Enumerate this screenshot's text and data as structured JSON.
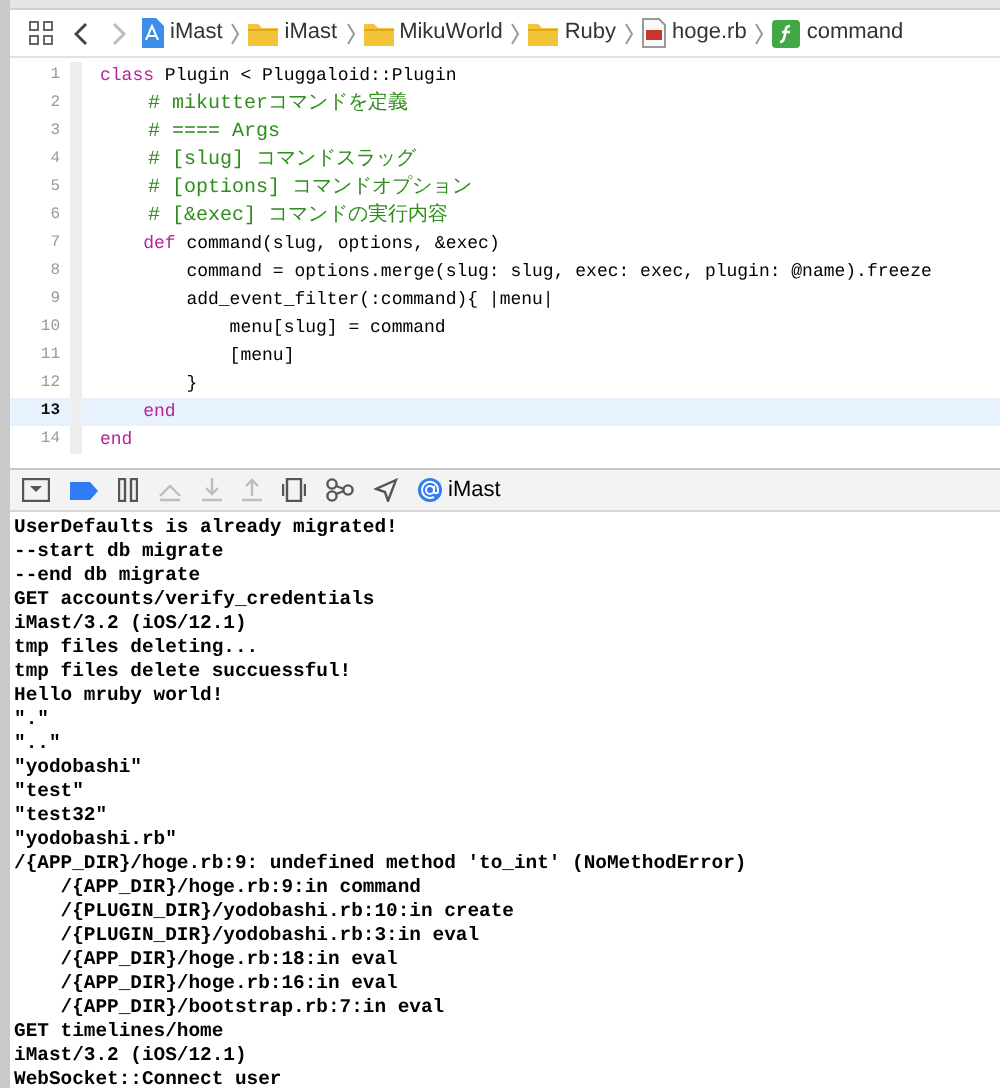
{
  "jump_bar": {
    "back": {
      "disabled": false
    },
    "forward": {
      "disabled": true
    },
    "path": [
      {
        "label": "iMast",
        "kind": "project"
      },
      {
        "label": "iMast",
        "kind": "folder"
      },
      {
        "label": "MikuWorld",
        "kind": "folder"
      },
      {
        "label": "Ruby",
        "kind": "folder"
      },
      {
        "label": "hoge.rb",
        "kind": "ruby-file"
      },
      {
        "label": "command",
        "kind": "function"
      }
    ]
  },
  "editor": {
    "lines": [
      {
        "number": "1",
        "current": false,
        "tokens": [
          {
            "text": "class",
            "kind": "keyword"
          },
          {
            "text": " Plugin < Pluggaloid::Plugin",
            "kind": "plain"
          }
        ]
      },
      {
        "number": "2",
        "current": false,
        "tokens": [
          {
            "text": "    # mikutterコマンドを定義",
            "kind": "comment"
          }
        ]
      },
      {
        "number": "3",
        "current": false,
        "tokens": [
          {
            "text": "    # ==== Args",
            "kind": "comment"
          }
        ]
      },
      {
        "number": "4",
        "current": false,
        "tokens": [
          {
            "text": "    # [slug] コマンドスラッグ",
            "kind": "comment"
          }
        ]
      },
      {
        "number": "5",
        "current": false,
        "tokens": [
          {
            "text": "    # [options] コマンドオプション",
            "kind": "comment"
          }
        ]
      },
      {
        "number": "6",
        "current": false,
        "tokens": [
          {
            "text": "    # [&exec] コマンドの実行内容",
            "kind": "comment"
          }
        ]
      },
      {
        "number": "7",
        "current": false,
        "tokens": [
          {
            "text": "    def",
            "kind": "keyword"
          },
          {
            "text": " command(slug, options, &exec)",
            "kind": "plain"
          }
        ]
      },
      {
        "number": "8",
        "current": false,
        "tokens": [
          {
            "text": "        command = options.merge(slug: slug, exec: exec, plugin: @name).freeze",
            "kind": "plain"
          }
        ]
      },
      {
        "number": "9",
        "current": false,
        "tokens": [
          {
            "text": "        add_event_filter(:command){ |menu|",
            "kind": "plain"
          }
        ]
      },
      {
        "number": "10",
        "current": false,
        "tokens": [
          {
            "text": "            menu[slug] = command",
            "kind": "plain"
          }
        ]
      },
      {
        "number": "11",
        "current": false,
        "tokens": [
          {
            "text": "            [menu]",
            "kind": "plain"
          }
        ]
      },
      {
        "number": "12",
        "current": false,
        "tokens": [
          {
            "text": "        }",
            "kind": "plain"
          }
        ]
      },
      {
        "number": "13",
        "current": true,
        "tokens": [
          {
            "text": "    end",
            "kind": "keyword"
          }
        ]
      },
      {
        "number": "14",
        "current": false,
        "tokens": [
          {
            "text": "end",
            "kind": "keyword"
          }
        ]
      }
    ]
  },
  "debug_bar": {
    "buttons": [
      {
        "kind": "hide-panel",
        "active": false,
        "disabled": false
      },
      {
        "kind": "breakpoints",
        "active": true,
        "disabled": false
      },
      {
        "kind": "pause",
        "active": false,
        "disabled": false
      },
      {
        "kind": "step-over",
        "active": false,
        "disabled": true
      },
      {
        "kind": "step-into",
        "active": false,
        "disabled": true
      },
      {
        "kind": "step-out",
        "active": false,
        "disabled": true
      },
      {
        "kind": "view-hierarchy",
        "active": false,
        "disabled": false
      },
      {
        "kind": "memory-graph",
        "active": false,
        "disabled": false
      },
      {
        "kind": "location",
        "active": false,
        "disabled": false
      }
    ],
    "process": "iMast"
  },
  "console": {
    "lines": [
      "UserDefaults is already migrated!",
      "--start db migrate",
      "--end db migrate",
      "GET accounts/verify_credentials",
      "iMast/3.2 (iOS/12.1)",
      "tmp files deleting...",
      "tmp files delete succuessful!",
      "Hello mruby world!",
      "\".\"",
      "\"..\"",
      "\"yodobashi\"",
      "\"test\"",
      "\"test32\"",
      "\"yodobashi.rb\"",
      "/{APP_DIR}/hoge.rb:9: undefined method 'to_int' (NoMethodError)",
      "    /{APP_DIR}/hoge.rb:9:in command",
      "    /{PLUGIN_DIR}/yodobashi.rb:10:in create",
      "    /{PLUGIN_DIR}/yodobashi.rb:3:in eval",
      "    /{APP_DIR}/hoge.rb:18:in eval",
      "    /{APP_DIR}/hoge.rb:16:in eval",
      "    /{APP_DIR}/bootstrap.rb:7:in eval",
      "GET timelines/home",
      "iMast/3.2 (iOS/12.1)",
      "WebSocket::Connect user"
    ]
  }
}
